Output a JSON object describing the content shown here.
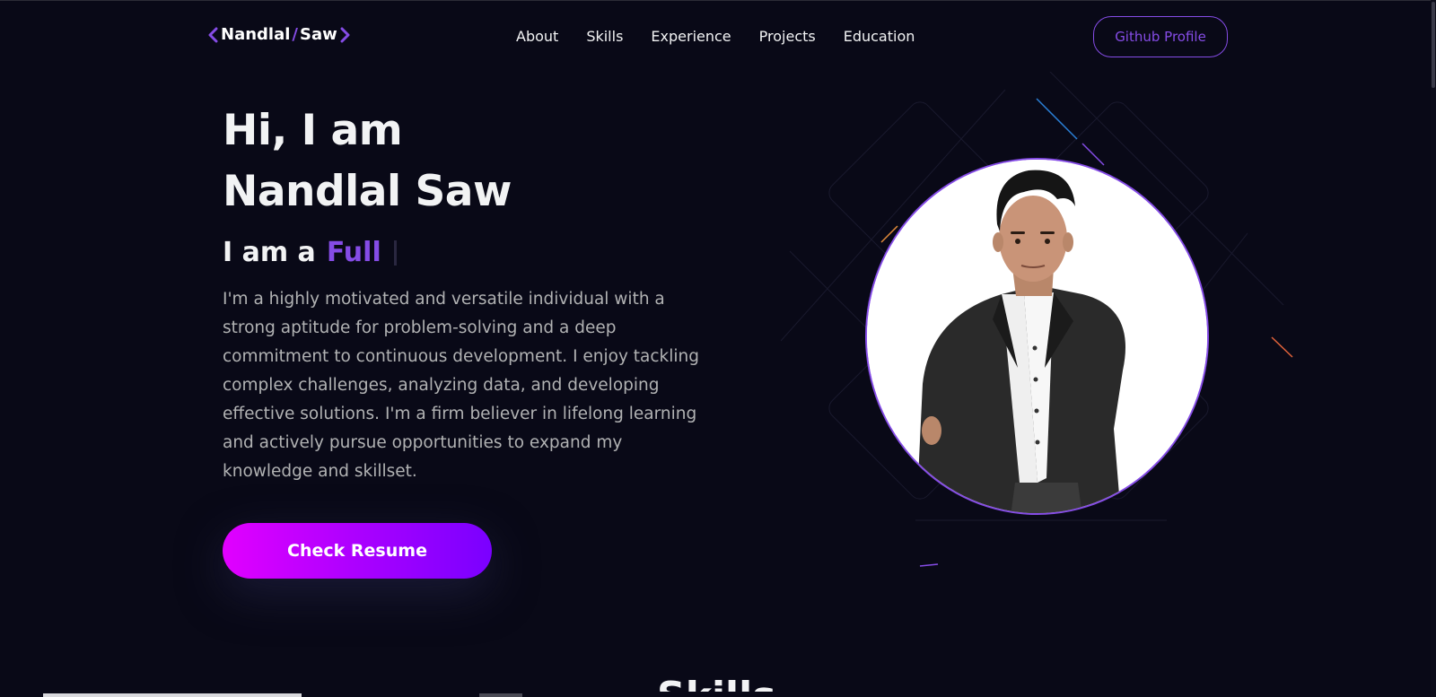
{
  "nav": {
    "logo_first": "Nandlal",
    "logo_sep": "/",
    "logo_second": "Saw",
    "links": [
      "About",
      "Skills",
      "Experience",
      "Projects",
      "Education"
    ],
    "github_label": "Github Profile"
  },
  "hero": {
    "greeting_line1": "Hi, I am",
    "greeting_line2": "Nandlal Saw",
    "role_prefix": "I am a",
    "role_typed": "Full",
    "description": "I'm a highly motivated and versatile individual with a strong aptitude for problem-solving and a deep commitment to continuous development. I enjoy tackling complex challenges, analyzing data, and developing effective solutions. I'm a firm believer in lifelong learning and actively pursue opportunities to expand my knowledge and skillset.",
    "resume_label": "Check Resume"
  },
  "next_section": {
    "title_peek": "Skills"
  },
  "colors": {
    "background": "#090917",
    "accent": "#854ce6",
    "text_primary": "#f2f3f4",
    "text_secondary": "#b1b2b3"
  }
}
